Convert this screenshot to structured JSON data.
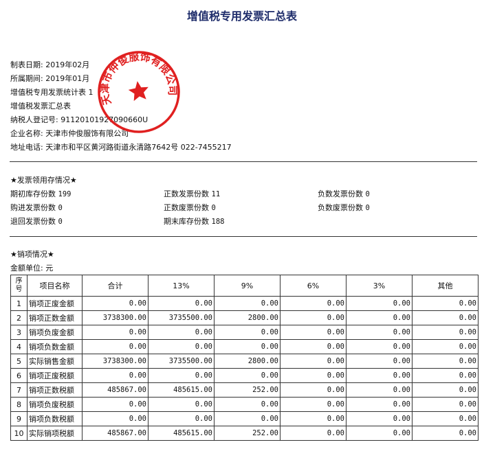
{
  "title": "增值税专用发票汇总表",
  "header": {
    "make_date": "制表日期: 2019年02月",
    "period": "所属期间: 2019年01月",
    "stat_table": "增值税专用发票统计表 1",
    "summary_table": "增值税发票汇总表",
    "taxpayer_id": "纳税人登记号: 91120101927090660U",
    "company": "企业名称: 天津市仲俊服饰有限公司",
    "address": "地址电话: 天津市和平区黄河路街道永清路7642号 022-7455217"
  },
  "seal": {
    "text": "天津市仲俊服饰有限公司",
    "color": "#e02020"
  },
  "invoice_section": {
    "heading": "★发票领用存情况★",
    "items": [
      {
        "label": "期初库存份数",
        "value": "199"
      },
      {
        "label": "正数发票份数",
        "value": "11"
      },
      {
        "label": "负数发票份数",
        "value": "0"
      },
      {
        "label": "购进发票份数",
        "value": "0"
      },
      {
        "label": "正数废票份数",
        "value": "0"
      },
      {
        "label": "负数废票份数",
        "value": "0"
      },
      {
        "label": "退回发票份数",
        "value": "0"
      },
      {
        "label": "期末库存份数",
        "value": "188"
      }
    ]
  },
  "sales_section": {
    "heading": "★销项情况★",
    "unit": "金额单位: 元"
  },
  "table": {
    "headers": [
      "序号",
      "项目名称",
      "合计",
      "13%",
      "9%",
      "6%",
      "3%",
      "其他"
    ],
    "rows": [
      [
        "1",
        "销项正废金额",
        "0.00",
        "0.00",
        "0.00",
        "0.00",
        "0.00",
        "0.00"
      ],
      [
        "2",
        "销项正数金额",
        "3738300.00",
        "3735500.00",
        "2800.00",
        "0.00",
        "0.00",
        "0.00"
      ],
      [
        "3",
        "销项负废金额",
        "0.00",
        "0.00",
        "0.00",
        "0.00",
        "0.00",
        "0.00"
      ],
      [
        "4",
        "销项负数金额",
        "0.00",
        "0.00",
        "0.00",
        "0.00",
        "0.00",
        "0.00"
      ],
      [
        "5",
        "实际销售金额",
        "3738300.00",
        "3735500.00",
        "2800.00",
        "0.00",
        "0.00",
        "0.00"
      ],
      [
        "6",
        "销项正废税额",
        "0.00",
        "0.00",
        "0.00",
        "0.00",
        "0.00",
        "0.00"
      ],
      [
        "7",
        "销项正数税额",
        "485867.00",
        "485615.00",
        "252.00",
        "0.00",
        "0.00",
        "0.00"
      ],
      [
        "8",
        "销项负废税额",
        "0.00",
        "0.00",
        "0.00",
        "0.00",
        "0.00",
        "0.00"
      ],
      [
        "9",
        "销项负数税额",
        "0.00",
        "0.00",
        "0.00",
        "0.00",
        "0.00",
        "0.00"
      ],
      [
        "10",
        "实际销项税额",
        "485867.00",
        "485615.00",
        "252.00",
        "0.00",
        "0.00",
        "0.00"
      ]
    ]
  }
}
